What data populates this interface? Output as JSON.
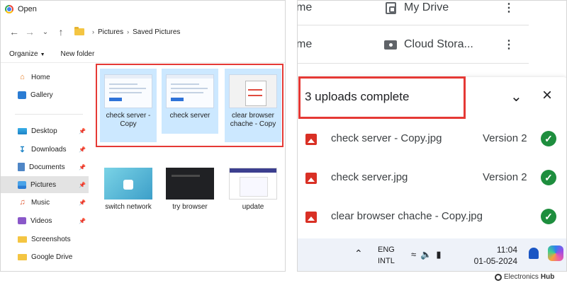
{
  "dialog": {
    "title": "Open",
    "breadcrumb": [
      "Pictures",
      "Saved Pictures"
    ],
    "toolbar": {
      "organize": "Organize",
      "new_folder": "New folder"
    },
    "sidebar": [
      {
        "label": "Home",
        "icon": "home-icon",
        "pinned": false
      },
      {
        "label": "Gallery",
        "icon": "gallery-icon",
        "pinned": false
      },
      {
        "label": "Desktop",
        "icon": "desktop-icon",
        "pinned": true
      },
      {
        "label": "Downloads",
        "icon": "download-icon",
        "pinned": true
      },
      {
        "label": "Documents",
        "icon": "documents-icon",
        "pinned": true
      },
      {
        "label": "Pictures",
        "icon": "pictures-icon",
        "pinned": true,
        "active": true
      },
      {
        "label": "Music",
        "icon": "music-icon",
        "pinned": true
      },
      {
        "label": "Videos",
        "icon": "videos-icon",
        "pinned": true
      },
      {
        "label": "Screenshots",
        "icon": "folder-icon",
        "pinned": false
      },
      {
        "label": "Google Drive",
        "icon": "folder-icon",
        "pinned": false
      }
    ],
    "files": [
      {
        "name": "check server - Copy",
        "selected": true
      },
      {
        "name": "check server",
        "selected": true
      },
      {
        "name": "clear browser chache - Copy",
        "selected": true
      },
      {
        "name": "switch network",
        "selected": false
      },
      {
        "name": "try browser",
        "selected": false
      },
      {
        "name": "update",
        "selected": false
      }
    ]
  },
  "drive": {
    "nav": [
      {
        "left_text": "me",
        "label": "My Drive",
        "icon": "my-drive-icon"
      },
      {
        "left_text": "me",
        "label": "Cloud Stora...",
        "icon": "cloud-storage-icon"
      }
    ],
    "uploads": {
      "title": "3 uploads complete",
      "items": [
        {
          "name": "check server - Copy.jpg",
          "version": "Version 2"
        },
        {
          "name": "check server.jpg",
          "version": "Version 2"
        },
        {
          "name": "clear browser chache - Copy.jpg",
          "version": ""
        }
      ]
    },
    "taskbar": {
      "lang_line1": "ENG",
      "lang_line2": "INTL",
      "time": "11:04",
      "date": "01-05-2024"
    }
  },
  "watermark": {
    "prefix": "Electronics",
    "suffix": "Hub"
  },
  "colors": {
    "highlight": "#e53935",
    "selection": "#cce8ff",
    "success": "#1e8e3e",
    "image_icon": "#d93025"
  }
}
